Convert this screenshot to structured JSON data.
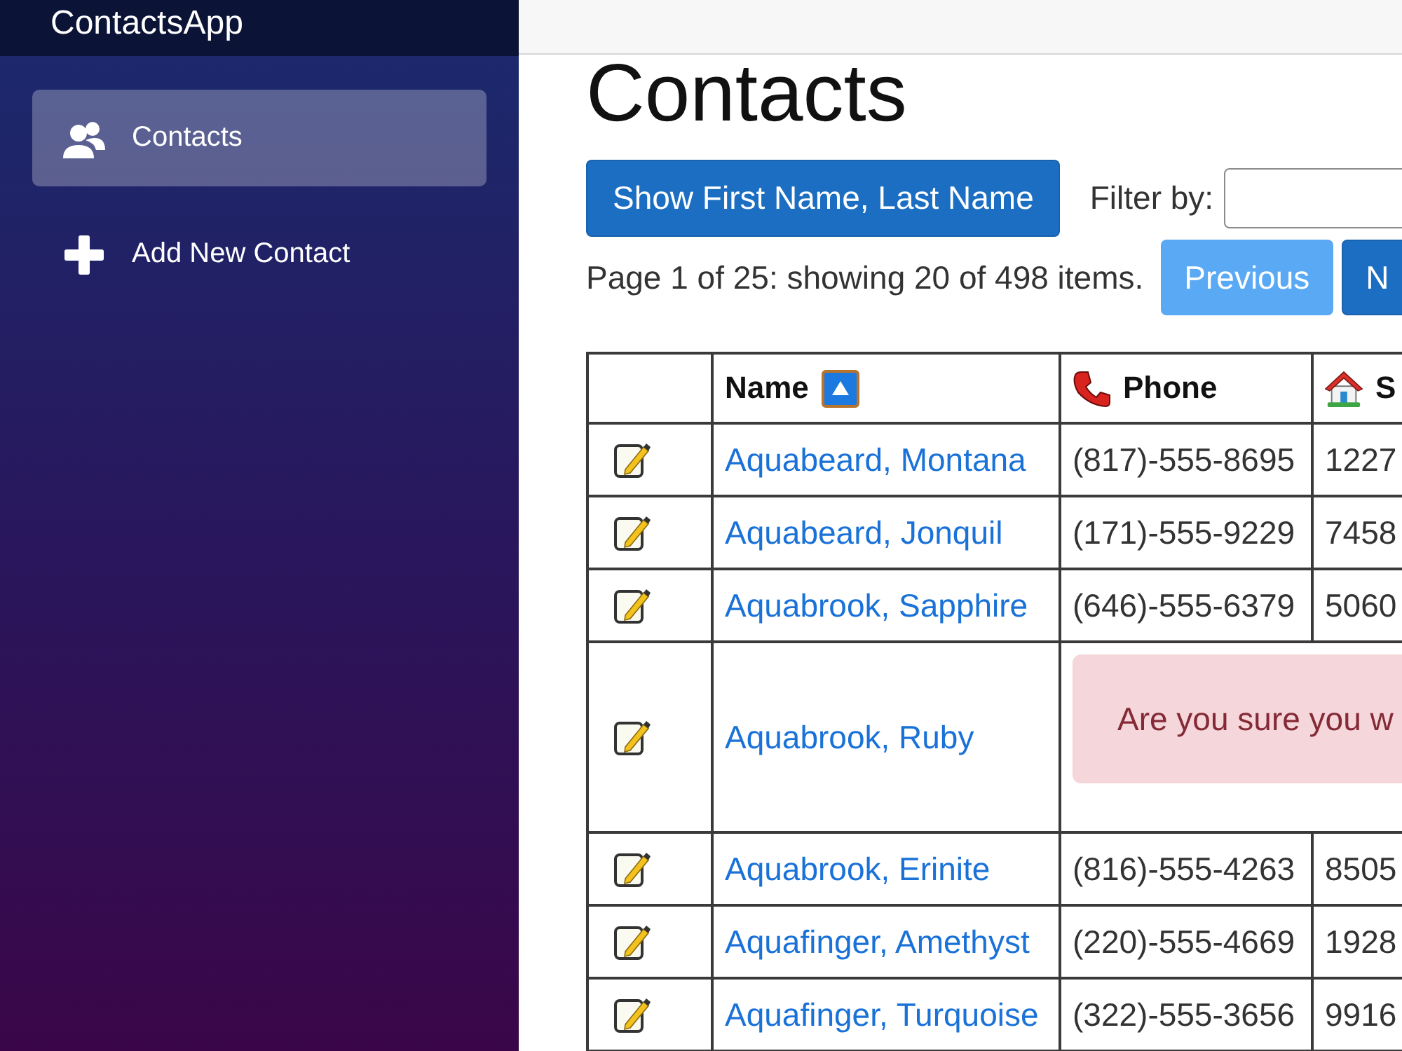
{
  "app": {
    "title": "ContactsApp"
  },
  "sidebar": {
    "items": [
      {
        "label": "Contacts",
        "selected": true
      },
      {
        "label": "Add New Contact",
        "selected": false
      }
    ]
  },
  "page": {
    "heading": "Contacts",
    "name_toggle": "Show First Name, Last Name",
    "filter": {
      "label": "Filter by:"
    }
  },
  "pager": {
    "summary": "Page 1 of 25: showing 20 of 498 items.",
    "buttons": [
      {
        "label": "Previous",
        "disabled": true
      },
      {
        "label": "N",
        "disabled": false
      }
    ]
  },
  "table": {
    "columns": [
      {
        "label": "Name",
        "sorted": true
      },
      {
        "label": "Phone",
        "sorted": false
      },
      {
        "label": "S",
        "sorted": false
      }
    ],
    "rows": [
      {
        "kind": "contact",
        "name": "Aquabeard, Montana",
        "phone": "(817)-555-8695",
        "column_3": "1227"
      },
      {
        "kind": "contact",
        "name": "Aquabeard, Jonquil",
        "phone": "(171)-555-9229",
        "column_3": "7458"
      },
      {
        "kind": "contact",
        "name": "Aquabrook, Sapphire",
        "phone": "(646)-555-6379",
        "column_3": "5060"
      },
      {
        "kind": "confirm",
        "name": "Aquabrook, Ruby",
        "message": "Are you sure you w"
      },
      {
        "kind": "contact",
        "name": "Aquabrook, Erinite",
        "phone": "(816)-555-4263",
        "column_3": "8505"
      },
      {
        "kind": "contact",
        "name": "Aquafinger, Amethyst",
        "phone": "(220)-555-4669",
        "column_3": "1928"
      },
      {
        "kind": "contact",
        "name": "Aquafinger, Turquoise",
        "phone": "(322)-555-3656",
        "column_3": "9916"
      }
    ]
  }
}
